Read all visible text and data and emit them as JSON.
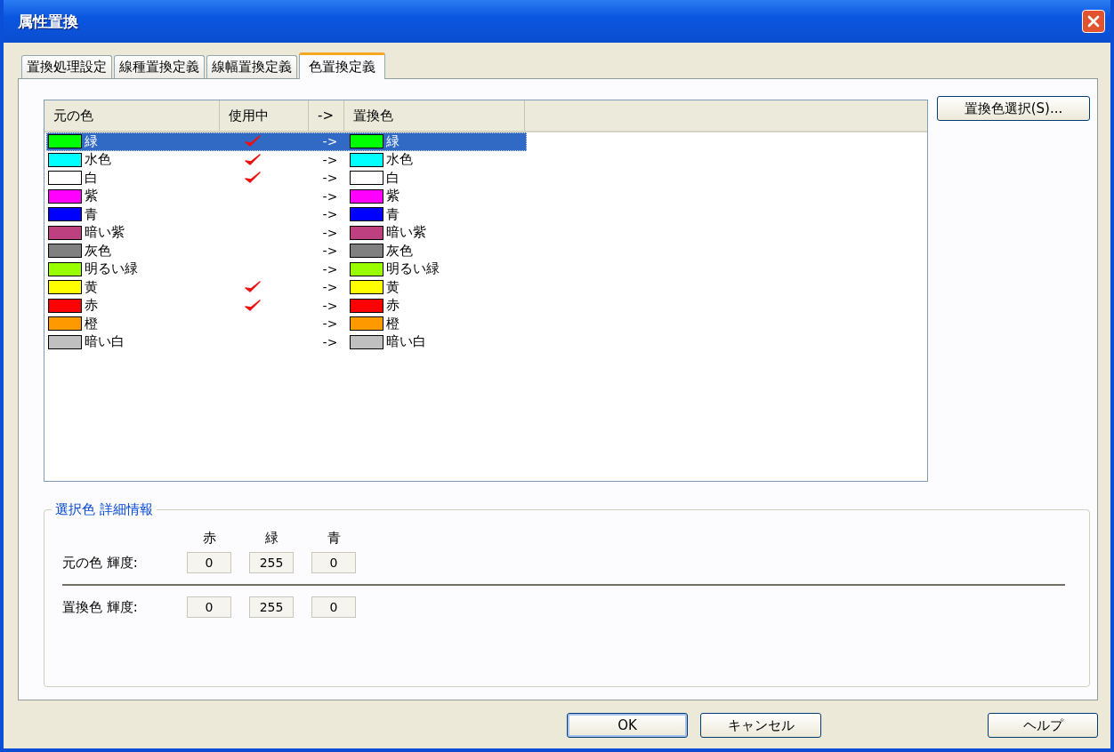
{
  "window": {
    "title": "属性置換"
  },
  "tabs": [
    {
      "label": "置換処理設定",
      "selected": false
    },
    {
      "label": "線種置換定義",
      "selected": false
    },
    {
      "label": "線幅置換定義",
      "selected": false
    },
    {
      "label": "色置換定義",
      "selected": true
    }
  ],
  "list": {
    "columns": [
      "元の色",
      "使用中",
      "->",
      "置換色"
    ],
    "rows": [
      {
        "original": {
          "color": "#00ff00",
          "name": "緑"
        },
        "in_use": true,
        "arrow": "->",
        "replacement": {
          "color": "#00ff00",
          "name": "緑"
        },
        "selected": true
      },
      {
        "original": {
          "color": "#00ffff",
          "name": "水色"
        },
        "in_use": true,
        "arrow": "->",
        "replacement": {
          "color": "#00ffff",
          "name": "水色"
        },
        "selected": false
      },
      {
        "original": {
          "color": "#ffffff",
          "name": "白"
        },
        "in_use": true,
        "arrow": "->",
        "replacement": {
          "color": "#ffffff",
          "name": "白"
        },
        "selected": false
      },
      {
        "original": {
          "color": "#ff00ff",
          "name": "紫"
        },
        "in_use": false,
        "arrow": "->",
        "replacement": {
          "color": "#ff00ff",
          "name": "紫"
        },
        "selected": false
      },
      {
        "original": {
          "color": "#0000ff",
          "name": "青"
        },
        "in_use": false,
        "arrow": "->",
        "replacement": {
          "color": "#0000ff",
          "name": "青"
        },
        "selected": false
      },
      {
        "original": {
          "color": "#bf4080",
          "name": "暗い紫"
        },
        "in_use": false,
        "arrow": "->",
        "replacement": {
          "color": "#bf4080",
          "name": "暗い紫"
        },
        "selected": false
      },
      {
        "original": {
          "color": "#808080",
          "name": "灰色"
        },
        "in_use": false,
        "arrow": "->",
        "replacement": {
          "color": "#808080",
          "name": "灰色"
        },
        "selected": false
      },
      {
        "original": {
          "color": "#99ff00",
          "name": "明るい緑"
        },
        "in_use": false,
        "arrow": "->",
        "replacement": {
          "color": "#99ff00",
          "name": "明るい緑"
        },
        "selected": false
      },
      {
        "original": {
          "color": "#ffff00",
          "name": "黄"
        },
        "in_use": true,
        "arrow": "->",
        "replacement": {
          "color": "#ffff00",
          "name": "黄"
        },
        "selected": false
      },
      {
        "original": {
          "color": "#ff0000",
          "name": "赤"
        },
        "in_use": true,
        "arrow": "->",
        "replacement": {
          "color": "#ff0000",
          "name": "赤"
        },
        "selected": false
      },
      {
        "original": {
          "color": "#ff9900",
          "name": "橙"
        },
        "in_use": false,
        "arrow": "->",
        "replacement": {
          "color": "#ff9900",
          "name": "橙"
        },
        "selected": false
      },
      {
        "original": {
          "color": "#c0c0c0",
          "name": "暗い白"
        },
        "in_use": false,
        "arrow": "->",
        "replacement": {
          "color": "#c0c0c0",
          "name": "暗い白"
        },
        "selected": false
      }
    ]
  },
  "select_button": "置換色選択(S)...",
  "details": {
    "title": "選択色 詳細情報",
    "channel_headers": [
      "赤",
      "緑",
      "青"
    ],
    "rows": [
      {
        "label": "元の色 輝度:",
        "values": [
          "0",
          "255",
          "0"
        ]
      },
      {
        "label": "置換色 輝度:",
        "values": [
          "0",
          "255",
          "0"
        ]
      }
    ]
  },
  "buttons": [
    {
      "label": "OK",
      "default": true
    },
    {
      "label": "キャンセル",
      "default": false
    },
    {
      "label": "ヘルプ",
      "default": false
    }
  ]
}
